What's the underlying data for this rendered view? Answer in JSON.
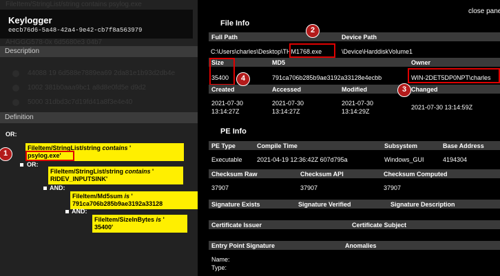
{
  "left_panel": {
    "title": "Keylogger",
    "guid": "eecb76d6-5a48-42a4-9e42-cb7f8a563979",
    "ghost_lines": [
      "FileItem/StringList/string contains psylog.exe",
      "AHGGG578-0x  6d5680e3 04b7"
    ],
    "ghost_rows": [
      "44088 19   6d588e7889ea69 2da81e1b93d2db4e",
      "1002   381b0aaa9bc1 a8d8e0fd5e d9d2",
      "5000   31dbd3c7d19fd41a8f3e4e40"
    ],
    "description_label": "Description",
    "definition_label": "Definition",
    "tree": {
      "or1": "OR:",
      "or2": "OR:",
      "and1": "AND:",
      "and2": "AND:",
      "item1_a": "FileItem/StringList/string",
      "item1_op": "contains",
      "item1_b": "psylog.exe",
      "item2_a": "FileItem/StringList/string",
      "item2_op": "contains",
      "item2_b": "RIDEV_INPUTSINK",
      "item3_a": "FileItem/Md5sum",
      "item3_op": "is",
      "item3_b": "791ca706b285b9ae3192a33128",
      "item4_a": "FileItem/SizeInBytes",
      "item4_op": "is",
      "item4_b": "35400"
    }
  },
  "right_panel": {
    "close_label": "close pane",
    "file_info_title": "File Info",
    "full_path_label": "Full Path",
    "device_path_label": "Device Path",
    "full_path_prefix": "C:\\Users\\charles\\Desktop\\",
    "full_path_file": "THM1768.exe",
    "device_path_value": "\\Device\\HarddiskVolume1",
    "size_label": "Size",
    "md5_label": "MD5",
    "owner_label": "Owner",
    "size_value": "35400",
    "md5_value": "791ca706b285b9ae3192a33128e4ecbb",
    "owner_value": "WIN-2DET5DP0NPT\\charles",
    "created_label": "Created",
    "accessed_label": "Accessed",
    "modified_label": "Modified",
    "changed_label": "Changed",
    "created_date": "2021-07-30",
    "created_time": "13:14:27Z",
    "accessed_date": "2021-07-30",
    "accessed_time": "13:14:27Z",
    "modified_date": "2021-07-30",
    "modified_time": "13:14:29Z",
    "changed_value": "2021-07-30 13:14:59Z",
    "pe_info_title": "PE Info",
    "pe_type_label": "PE Type",
    "compile_time_label": "Compile Time",
    "subsystem_label": "Subsystem",
    "base_address_label": "Base Address",
    "pe_type_value": "Executable",
    "compile_time_value": "2021-04-19 12:36:42Z 607d795a",
    "subsystem_value": "Windows_GUI",
    "base_address_value": "4194304",
    "checksum_raw_label": "Checksum Raw",
    "checksum_api_label": "Checksum API",
    "checksum_computed_label": "Checksum Computed",
    "checksum_raw_value": "37907",
    "checksum_api_value": "37907",
    "checksum_computed_value": "37907",
    "sig_exists_label": "Signature Exists",
    "sig_verified_label": "Signature Verified",
    "sig_description_label": "Signature Description",
    "cert_issuer_label": "Certificate Issuer",
    "cert_subject_label": "Certificate Subject",
    "entry_point_sig_label": "Entry Point Signature",
    "anomalies_label": "Anomalies",
    "name_label": "Name:",
    "type_label": "Type:"
  },
  "annotations": [
    "1",
    "2",
    "3",
    "4"
  ],
  "colors": {
    "highlight": "#ffef00",
    "callout": "#b31b1b",
    "outline": "#e00000"
  }
}
